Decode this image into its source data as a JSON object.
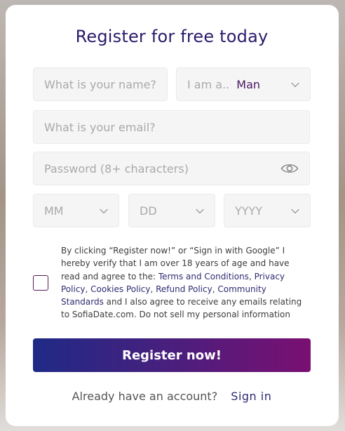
{
  "form": {
    "title": "Register for free today",
    "name_placeholder": "What is your name?",
    "gender_label": "I am a..",
    "gender_value": "Man",
    "email_placeholder": "What is your email?",
    "password_placeholder": "Password (8+ characters)",
    "month_placeholder": "MM",
    "day_placeholder": "DD",
    "year_placeholder": "YYYY",
    "terms": {
      "part1": "By clicking “Register now!” or “Sign in with Google” I hereby verify that I am over 18 years of age and have read and agree to the: ",
      "terms_link": "Terms and Conditions",
      "sep1": ", ",
      "privacy_link": "Privacy Policy",
      "sep2": ", ",
      "cookies_link": "Cookies Policy",
      "sep3": ", ",
      "refund_link": "Refund Policy",
      "sep4": ",  ",
      "community_link": "Community Standards",
      "part2": " and I also agree to receive any emails relating to SofiaDate.com. Do not sell my personal information"
    },
    "register_label": "Register now!",
    "account_prompt": "Already have an account?",
    "signin_label": "Sign in"
  },
  "colors": {
    "title": "#2b1b6b",
    "link": "#2e2b72",
    "gender_value": "#4a1763",
    "button_start": "#1f2a86",
    "button_end": "#7a0f72",
    "checkbox_border": "#5a1b57"
  },
  "icons": {
    "password_toggle": "eye-icon",
    "dropdown": "chevron-down-icon"
  }
}
